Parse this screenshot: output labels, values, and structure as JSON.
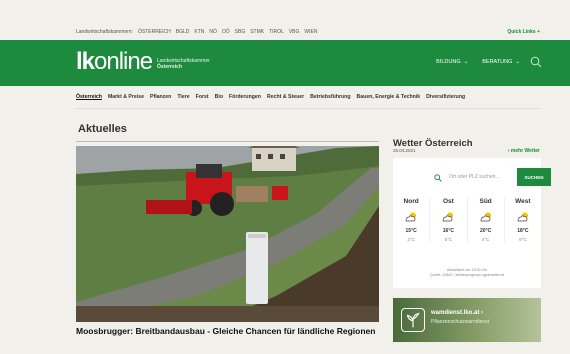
{
  "topbar": {
    "chambers": [
      "Landwirtschaftskammern:",
      "ÖSTERREICH",
      "BGLD",
      "KTN",
      "NÖ",
      "OÖ",
      "SBG",
      "STMK",
      "TIROL",
      "VBG",
      "WIEN"
    ],
    "quick_links": "Quick Links +"
  },
  "header": {
    "logo_lk": "lk",
    "logo_online": "online",
    "logo_sub1": "Landwirtschaftskammer",
    "logo_sub2": "Österreich",
    "nav": [
      {
        "label": "BILDUNG"
      },
      {
        "label": "BERATUNG"
      }
    ]
  },
  "mainnav": [
    "Österreich",
    "Markt & Preise",
    "Pflanzen",
    "Tiere",
    "Forst",
    "Bio",
    "Förderungen",
    "Recht & Steuer",
    "Betriebsführung",
    "Bauen, Energie & Technik",
    "Diversifizierung"
  ],
  "section": {
    "title": "Aktuelles"
  },
  "article": {
    "headline": "Moosbrugger: Breitbandausbau - Gleiche Chancen für ländliche Regionen"
  },
  "weather": {
    "title": "Wetter Österreich",
    "date": "25.04.2021",
    "more": "› mehr Wetter",
    "search_placeholder": "Ort oder PLZ suchen...",
    "search_button": "SUCHEN",
    "regions": [
      {
        "name": "Nord",
        "icon": "partly-cloudy-icon",
        "high": "15°C",
        "low": "3°C"
      },
      {
        "name": "Ost",
        "icon": "partly-cloudy-icon",
        "high": "16°C",
        "low": "5°C"
      },
      {
        "name": "Süd",
        "icon": "partly-cloudy-icon",
        "high": "20°C",
        "low": "4°C"
      },
      {
        "name": "West",
        "icon": "partly-cloudy-icon",
        "high": "18°C",
        "low": "6°C"
      }
    ],
    "footer1": "Aktualisiert um 13:00 Uhr",
    "footer2": "Quelle: ZAMG | Wetterprognose agrarwetter.at"
  },
  "promo": {
    "title": "wamdienst.lko.at ›",
    "subtitle": "Pflanzenschutzwarndienst"
  },
  "colors": {
    "brand": "#1d8a3e",
    "background": "#f1f0ea"
  }
}
